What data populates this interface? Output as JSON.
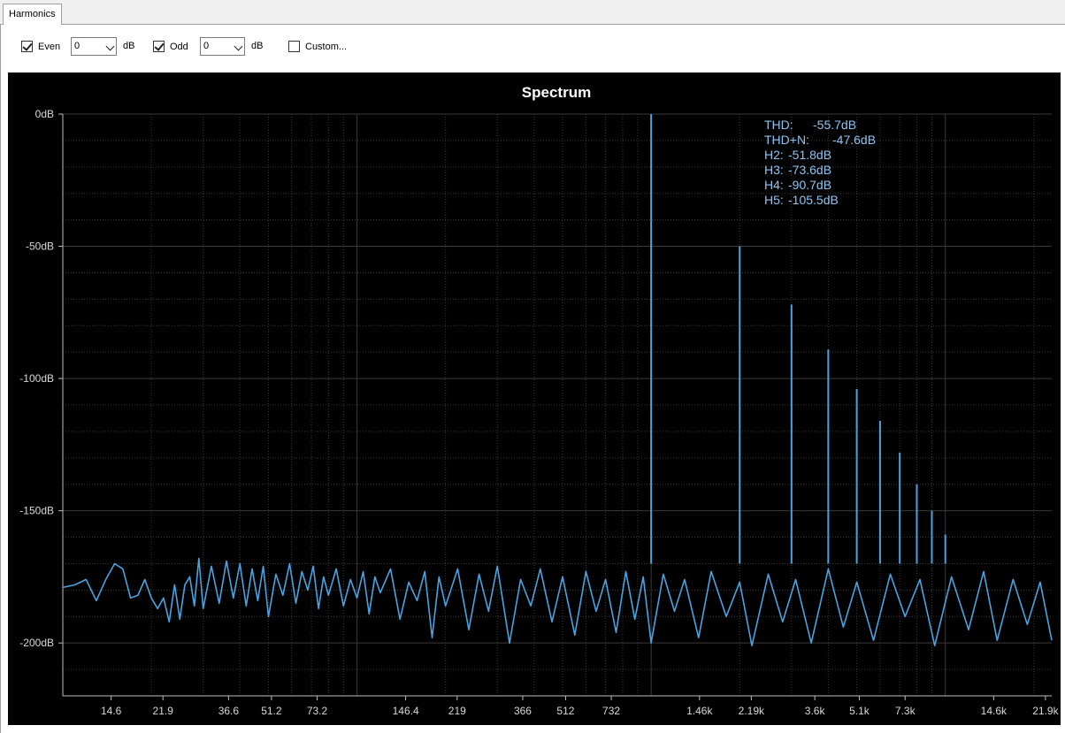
{
  "tab": {
    "label": "Harmonics"
  },
  "toolbar": {
    "even": {
      "label": "Even",
      "checked": true,
      "value": "0",
      "unit": "dB"
    },
    "odd": {
      "label": "Odd",
      "checked": true,
      "value": "0",
      "unit": "dB"
    },
    "custom": {
      "label": "Custom...",
      "checked": false
    }
  },
  "colors": {
    "background": "#000000",
    "series": "#4aa3e0",
    "axis_text": "#d8d8d8",
    "stats_text": "#8fc4f0",
    "grid": "#3a3a3a"
  },
  "chart_data": {
    "type": "line",
    "title": "Spectrum",
    "x_scale": "log",
    "xlim": [
      10,
      23000
    ],
    "ylim": [
      -220,
      0
    ],
    "grid": true,
    "x_ticks": [
      "14.6",
      "21.9",
      "36.6",
      "51.2",
      "73.2",
      "146.4",
      "219",
      "366",
      "512",
      "732",
      "1.46k",
      "2.19k",
      "3.6k",
      "5.1k",
      "7.3k",
      "14.6k",
      "21.9k"
    ],
    "y_ticks": [
      "0dB",
      "-50dB",
      "-100dB",
      "-150dB",
      "-200dB"
    ],
    "stats": [
      {
        "label": "THD:",
        "value": "-55.7dB"
      },
      {
        "label": "THD+N:",
        "value": "-47.6dB"
      },
      {
        "label": "H2:",
        "value": "-51.8dB"
      },
      {
        "label": "H3:",
        "value": "-73.6dB"
      },
      {
        "label": "H4:",
        "value": "-90.7dB"
      },
      {
        "label": "H5:",
        "value": "-105.5dB"
      }
    ],
    "peaks": [
      {
        "x": 1000,
        "y": 0
      },
      {
        "x": 2000,
        "y": -50
      },
      {
        "x": 3000,
        "y": -72
      },
      {
        "x": 4000,
        "y": -89
      },
      {
        "x": 5000,
        "y": -104
      },
      {
        "x": 6000,
        "y": -116
      },
      {
        "x": 7000,
        "y": -128
      },
      {
        "x": 8000,
        "y": -140
      },
      {
        "x": 9000,
        "y": -150
      },
      {
        "x": 10000,
        "y": -159
      }
    ],
    "series": [
      {
        "x": [
          10,
          11,
          12,
          13,
          14,
          15,
          16,
          17,
          18,
          19,
          20,
          21,
          22,
          23,
          24,
          25,
          26,
          27,
          28,
          29,
          30,
          32,
          34,
          36,
          38,
          40,
          42,
          44,
          46,
          48,
          50,
          53,
          56,
          59,
          62,
          65,
          68,
          71,
          74,
          77,
          80,
          85,
          90,
          95,
          100,
          105,
          110,
          115,
          120,
          130,
          140,
          150,
          160,
          170,
          180,
          190,
          200,
          220,
          240,
          260,
          280,
          300,
          330,
          360,
          390,
          420,
          460,
          500,
          550,
          600,
          650,
          700,
          760,
          820,
          880,
          940,
          1000,
          1100,
          1200,
          1300,
          1450,
          1600,
          1800,
          2000,
          2200,
          2500,
          2800,
          3100,
          3500,
          4000,
          4500,
          5000,
          5700,
          6500,
          7300,
          8200,
          9200,
          10500,
          12000,
          13500,
          15000,
          17000,
          19000,
          21000,
          23000
        ],
        "y": [
          -179,
          -178,
          -176,
          -184,
          -176,
          -170,
          -172,
          -183,
          -182,
          -176,
          -183,
          -187,
          -183,
          -192,
          -178,
          -191,
          -178,
          -175,
          -186,
          -168,
          -187,
          -171,
          -185,
          -169,
          -183,
          -170,
          -186,
          -172,
          -184,
          -171,
          -190,
          -174,
          -182,
          -170,
          -185,
          -173,
          -180,
          -171,
          -187,
          -175,
          -182,
          -172,
          -186,
          -176,
          -183,
          -173,
          -189,
          -175,
          -181,
          -172,
          -191,
          -177,
          -184,
          -173,
          -198,
          -175,
          -186,
          -172,
          -195,
          -174,
          -188,
          -171,
          -200,
          -176,
          -186,
          -172,
          -192,
          -175,
          -197,
          -173,
          -188,
          -176,
          -196,
          -173,
          -191,
          -175,
          -200,
          -174,
          -188,
          -176,
          -198,
          -173,
          -190,
          -177,
          -201,
          -174,
          -192,
          -176,
          -200,
          -172,
          -194,
          -177,
          -199,
          -174,
          -190,
          -176,
          -201,
          -175,
          -195,
          -173,
          -199,
          -176,
          -193,
          -177,
          -199
        ]
      }
    ]
  }
}
